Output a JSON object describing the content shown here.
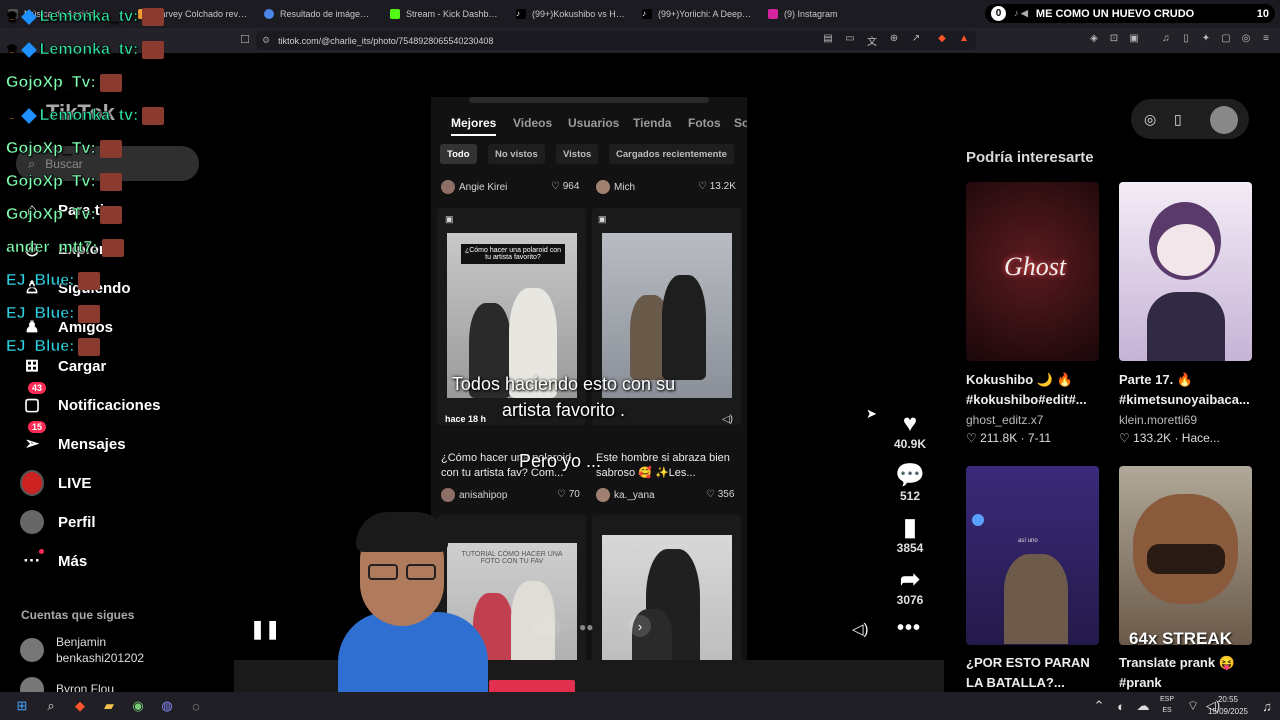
{
  "browser": {
    "tabs": [
      {
        "title": "Música de Acción y",
        "color": "#555"
      },
      {
        "title": "Harvey Colchado revela ex",
        "color": "#f0a030"
      },
      {
        "title": "Resultado de imágenes de",
        "color": "#4a86e8"
      },
      {
        "title": "Stream - Kick Dashboard",
        "color": "#53fc18"
      },
      {
        "title": "(99+)Kokushibo vs Hashira",
        "color": "#fff"
      },
      {
        "title": "(99+)Yoriichi: A Deep Dive",
        "color": "#fff"
      },
      {
        "title": "(9) Instagram",
        "color": "#d6249f"
      }
    ],
    "pinned_tab": "Kickletapp - Kick C...",
    "stream_title": "ME COMO UN HUEVO CRUDO",
    "stream_left_badge": "0",
    "stream_right_count": "10",
    "url": "tiktok.com/@charlie_its/photo/7548928065540230408"
  },
  "chat": [
    {
      "user": "Lemonka_tv:",
      "color": "#2fe0a0",
      "crown": true
    },
    {
      "user": "Lemonka_tv:",
      "color": "#2fe0a0",
      "crown": true
    },
    {
      "user": "GojoXp_Tv:",
      "color": "#7fffb0",
      "crown": false
    },
    {
      "user": "Lemonka_tv:",
      "color": "#2fe0a0",
      "crown": true
    },
    {
      "user": "GojoXp_Tv:",
      "color": "#7fffb0",
      "crown": false
    },
    {
      "user": "GojoXp_Tv:",
      "color": "#7fffb0",
      "crown": false
    },
    {
      "user": "GojoXp_Tv:",
      "color": "#7fffb0",
      "crown": false
    },
    {
      "user": "ander_mtt7:",
      "color": "#7fffb0",
      "crown": false
    },
    {
      "user": "EJ_Blue:",
      "color": "#2ecfe0",
      "crown": false
    },
    {
      "user": "EJ_Blue:",
      "color": "#2ecfe0",
      "crown": false
    },
    {
      "user": "EJ_Blue:",
      "color": "#2ecfe0",
      "crown": false
    }
  ],
  "sidebar": {
    "logo": "TikTok",
    "search_placeholder": "Buscar",
    "items": [
      {
        "label": "Para ti",
        "icon": "home-icon"
      },
      {
        "label": "Explorar",
        "icon": "compass-icon"
      },
      {
        "label": "Siguiendo",
        "icon": "following-icon"
      },
      {
        "label": "Amigos",
        "icon": "friends-icon"
      },
      {
        "label": "Cargar",
        "icon": "upload-icon"
      },
      {
        "label": "Notificaciones",
        "icon": "inbox-icon",
        "badge": "43"
      },
      {
        "label": "Mensajes",
        "icon": "messages-icon",
        "badge": "15"
      },
      {
        "label": "LIVE",
        "icon": "live-icon"
      },
      {
        "label": "Perfil",
        "icon": "profile-icon"
      },
      {
        "label": "Más",
        "icon": "more-icon"
      }
    ],
    "following_header": "Cuentas que sigues",
    "following": [
      {
        "name": "Benjamin",
        "handle": "benkashi201202"
      },
      {
        "name": "Byron Flou",
        "handle": ""
      }
    ]
  },
  "video": {
    "tabs": [
      "Mejores",
      "Videos",
      "Usuarios",
      "Tienda",
      "Fotos",
      "So"
    ],
    "chips": [
      "Todo",
      "No vistos",
      "Vistos",
      "Cargados recientemente"
    ],
    "top_row": [
      {
        "user": "Angie Kirei",
        "likes": "964"
      },
      {
        "user": "Mich",
        "likes": "13.2K"
      }
    ],
    "cards": [
      {
        "banner": "¿Cómo hacer una polaroid con tu artista favorito?",
        "time": "hace 18 h",
        "caption": "¿Cómo hacer una polaroid con tu artista fav? Com...",
        "user": "anisahipop",
        "likes": "70"
      },
      {
        "banner": "",
        "time": "",
        "caption": "Este hombre si abraza bien sabroso 🥰 ✨Les...",
        "user": "ka._yana",
        "likes": "356"
      },
      {
        "banner": "TUTORIAL CÓMO HACER UNA FOTO CON TU FAV",
        "time": "",
        "caption": "",
        "user": "",
        "likes": ""
      },
      {
        "banner": "",
        "time": "",
        "caption": "",
        "user": "",
        "likes": ""
      }
    ],
    "subtitle_line1": "Todos haciendo esto con su",
    "subtitle_line2": "artista favorito .",
    "subtitle_line3": "Pero yo ..."
  },
  "actions": {
    "likes": "40.9K",
    "comments": "512",
    "saves": "3854",
    "shares": "3076"
  },
  "right": {
    "title": "Podría interesarte",
    "cards": [
      {
        "title1": "Kokushibo 🌙 🔥",
        "title2": "#kokushibo#edit#...",
        "user": "ghost_editz.x7",
        "stats": "♡ 211.8K · 7-11",
        "thumb_text": "Ghost"
      },
      {
        "title1": "Parte 17. 🔥",
        "title2": "#kimetsunoyaibaca...",
        "user": "klein.moretti69",
        "stats": "♡ 133.2K · Hace...",
        "thumb_text": ""
      },
      {
        "title1": "¿POR ESTO PARAN",
        "title2": "LA BATALLA?...",
        "user": "",
        "stats": "",
        "thumb_text": "así uno"
      },
      {
        "title1": "Translate prank 😝",
        "title2": "#prank",
        "user": "",
        "stats": "",
        "thumb_text": "64x STREAK"
      }
    ]
  },
  "taskbar": {
    "lang1": "ESP",
    "lang2": "ES",
    "time": "20:55",
    "date": "15/09/2025"
  }
}
